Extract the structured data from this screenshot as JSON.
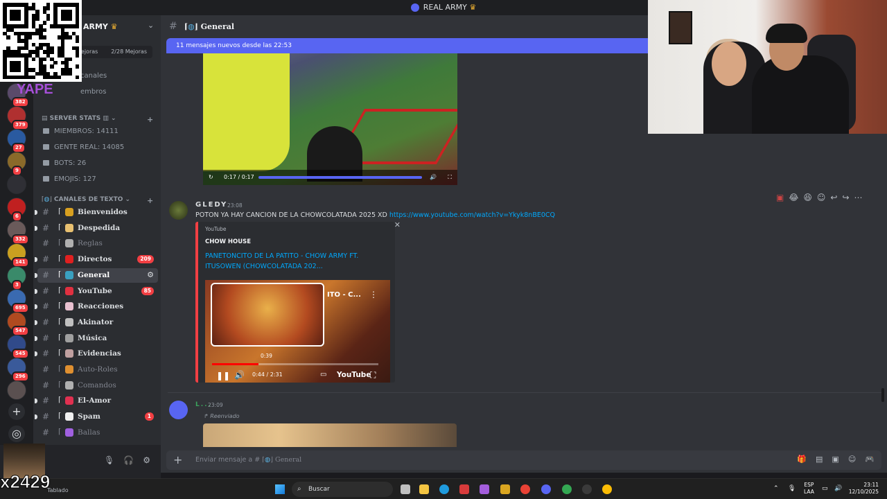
{
  "window": {
    "title": "REAL ARMY"
  },
  "qr_overlay": {
    "brand_text": "YAPE"
  },
  "server": {
    "name": "ARMY",
    "boost_left": "Mejoras",
    "boost_right": "2/28 Mejoras",
    "nav_channels": "canales",
    "nav_members": "embros"
  },
  "servers": [
    {
      "badge": "382"
    },
    {
      "badge": "379"
    },
    {
      "badge": "27"
    },
    {
      "badge": "9"
    },
    {
      "badge": ""
    },
    {
      "badge": "6"
    },
    {
      "badge": "332"
    },
    {
      "badge": "141"
    },
    {
      "badge": "3"
    },
    {
      "badge": "695"
    },
    {
      "badge": "547"
    },
    {
      "badge": "545"
    },
    {
      "badge": "296"
    },
    {
      "badge": ""
    }
  ],
  "stats": {
    "category": "SERVER STATS",
    "items": [
      "MIEMBROS: 14111",
      "GENTE REAL: 14085",
      "BOTS: 26",
      "EMOJIS: 127"
    ]
  },
  "text_category": "CANALES DE TEXTO",
  "channels": [
    {
      "name": "Bienvenidos",
      "badge": ""
    },
    {
      "name": "Despedida",
      "badge": ""
    },
    {
      "name": "Reglas",
      "badge": ""
    },
    {
      "name": "Directos",
      "badge": "209"
    },
    {
      "name": "General",
      "badge": ""
    },
    {
      "name": "YouTube",
      "badge": "85"
    },
    {
      "name": "Reacciones",
      "badge": ""
    },
    {
      "name": "Akinator",
      "badge": ""
    },
    {
      "name": "Música",
      "badge": ""
    },
    {
      "name": "Evidencias",
      "badge": ""
    },
    {
      "name": "Auto-Roles",
      "badge": ""
    },
    {
      "name": "Comandos",
      "badge": ""
    },
    {
      "name": "El-Amor",
      "badge": ""
    },
    {
      "name": "Spam",
      "badge": "1"
    },
    {
      "name": "Ballas",
      "badge": ""
    }
  ],
  "overlay": {
    "counter": "x2429",
    "status": "Tablado"
  },
  "chat": {
    "channel": "General",
    "new_messages": "11 mensajes nuevos desde las 22:53",
    "video1_time": "0:17 / 0:17",
    "video1_progress": 1.0,
    "message1": {
      "author": "GLEDY",
      "time": "23:08",
      "text": "POTON YA HAY CANCION DE LA CHOWCOLATADA 2025 XD",
      "link": "https://www.youtube.com/watch?v=Ykyk8nBE0CQ"
    },
    "embed": {
      "provider": "YouTube",
      "author": "CHOW HOUSE",
      "title": "PANETONCITO DE LA PATITO - CHOW ARMY FT. ITUSOWEN (CHOWCOLATADA 202...",
      "player_title": "ITO - C...",
      "hover_time": "0:39",
      "time": "0:44 / 2:31",
      "progress": 0.28,
      "brand": "YouTube"
    },
    "message2": {
      "author": "L...",
      "time": "23:09",
      "forwarded": "Reenviado"
    },
    "composer_placeholder": "Enviar mensaje a #",
    "composer_channel": "General"
  },
  "taskbar": {
    "search": "Buscar",
    "lang1": "ESP",
    "lang2": "LAA",
    "time": "23:11",
    "date": "12/10/2025"
  }
}
